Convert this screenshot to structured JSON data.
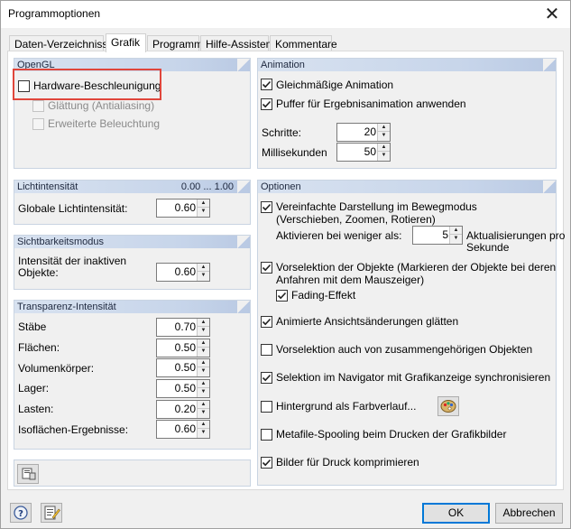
{
  "window": {
    "title": "Programmoptionen",
    "close_glyph": "✕"
  },
  "tabs": [
    {
      "label": "Daten-Verzeichnisse",
      "active": false
    },
    {
      "label": "Grafik",
      "active": true
    },
    {
      "label": "Programm",
      "active": false
    },
    {
      "label": "Hilfe-Assistent",
      "active": false
    },
    {
      "label": "Kommentare",
      "active": false
    }
  ],
  "opengl": {
    "title": "OpenGL",
    "hardware": {
      "label": "Hardware-Beschleunigung",
      "checked": false
    },
    "glattung": {
      "label": "Glättung (Antialiasing)",
      "checked": false,
      "enabled": false
    },
    "beleuchtung": {
      "label": "Erweiterte Beleuchtung",
      "checked": false,
      "enabled": false
    }
  },
  "licht": {
    "title": "Lichtintensität",
    "range": "0.00 ... 1.00",
    "global_label": "Globale Lichtintensität:",
    "global_value": "0.60"
  },
  "sicht": {
    "title": "Sichtbarkeitsmodus",
    "label_line1": "Intensität der inaktiven",
    "label_line2": "Objekte:",
    "value": "0.60"
  },
  "transparenz": {
    "title": "Transparenz-Intensität",
    "rows": [
      {
        "label": "Stäbe",
        "value": "0.70"
      },
      {
        "label": "Flächen:",
        "value": "0.50"
      },
      {
        "label": "Volumenkörper:",
        "value": "0.50"
      },
      {
        "label": "Lager:",
        "value": "0.50"
      },
      {
        "label": "Lasten:",
        "value": "0.20"
      },
      {
        "label": "Isoflächen-Ergebnisse:",
        "value": "0.60"
      }
    ]
  },
  "animation": {
    "title": "Animation",
    "gleichmaessig": {
      "label": "Gleichmäßige Animation",
      "checked": true
    },
    "puffer": {
      "label": "Puffer für Ergebnisanimation anwenden",
      "checked": true
    },
    "schritte_label": "Schritte:",
    "schritte_value": "20",
    "ms_label": "Millisekunden",
    "ms_value": "50"
  },
  "optionen": {
    "title": "Optionen",
    "vereinfacht": {
      "label_line1": "Vereinfachte Darstellung im Bewegmodus",
      "label_line2": "(Verschieben, Zoomen, Rotieren)",
      "checked": true
    },
    "aktivieren_label": "Aktivieren bei weniger als:",
    "aktivieren_value": "5",
    "aktualisierungen_line1": "Aktualisierungen pro",
    "aktualisierungen_line2": "Sekunde",
    "vorselektion": {
      "label_line1": "Vorselektion der Objekte (Markieren der Objekte bei deren",
      "label_line2": "Anfahren mit dem Mauszeiger)",
      "checked": true
    },
    "fading": {
      "label": "Fading-Effekt",
      "checked": true
    },
    "animierte": {
      "label": "Animierte Ansichtsänderungen glätten",
      "checked": true
    },
    "vorselektion_zus": {
      "label": "Vorselektion auch von zusammengehörigen Objekten",
      "checked": false
    },
    "selektion_nav": {
      "label": "Selektion im Navigator mit Grafikanzeige synchronisieren",
      "checked": true
    },
    "hintergrund": {
      "label": "Hintergrund als Farbverlauf...",
      "checked": false
    },
    "metafile": {
      "label": "Metafile-Spooling beim Drucken der Grafikbilder",
      "checked": false
    },
    "bilder": {
      "label": "Bilder für Druck komprimieren",
      "checked": true
    }
  },
  "footer": {
    "ok_label": "OK",
    "cancel_label": "Abbrechen"
  },
  "colors": {
    "highlight_box": "#e0463b",
    "group_header": "#c7d5ea",
    "default_button_border": "#0078d7"
  }
}
